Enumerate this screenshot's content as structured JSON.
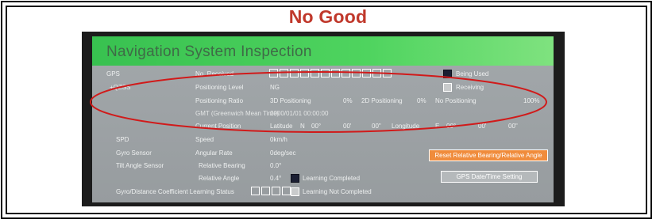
{
  "verdict": "No Good",
  "screen": {
    "title": "Navigation System Inspection",
    "rows": {
      "gps": "GPS",
      "qzss": "+QZSS",
      "no_received": "No. Received",
      "positioning_level": "Positioning Level",
      "positioning_level_value": "NG",
      "positioning_ratio": "Positioning Ratio",
      "ratio_3d": "3D Positioning",
      "ratio_3d_value": "0%",
      "ratio_2d": "2D Positioning",
      "ratio_2d_value": "0%",
      "ratio_none": "No Positioning",
      "ratio_none_value": "100%",
      "gmt": "GMT (Greenwich Mean Time)",
      "gmt_value": "2000/01/01    00:00:00",
      "current_position": "Current Position",
      "latitude": "Latitude",
      "lat_hemi": "N",
      "lat_deg": "00°",
      "lat_min": "00'",
      "lat_sec": "00\"",
      "longitude": "Longitude",
      "lon_hemi": "E",
      "lon_deg": "00°",
      "lon_min": "00'",
      "lon_sec": "00\"",
      "spd": "SPD",
      "speed": "Speed",
      "speed_value": "0km/h",
      "gyro_sensor": "Gyro Sensor",
      "angular_rate": "Angular Rate",
      "angular_rate_value": "0deg/sec",
      "tilt_sensor": "Tilt Angle Sensor",
      "relative_bearing": "Relative Bearing",
      "relative_bearing_value": "0.0°",
      "relative_angle": "Relative Angle",
      "relative_angle_value": "0.4°",
      "learning_status": "Gyro/Distance Coefficient Learning Status"
    },
    "legend": {
      "being_used": "Being Used",
      "receiving": "Receiving",
      "learning_completed": "Learning Completed",
      "learning_not_completed": "Learning Not Completed"
    },
    "buttons": {
      "reset": "Reset Relative Bearing/Relative Angle",
      "gps_datetime": "GPS Date/Time Setting"
    },
    "satellite_slots": 12,
    "learning_slots": 4
  },
  "colors": {
    "verdict": "#c0382b",
    "annotation": "#d11a1a",
    "title_bar": "#43c957",
    "being_used": "#1b1f33",
    "reset_button": "#f08c3c"
  }
}
